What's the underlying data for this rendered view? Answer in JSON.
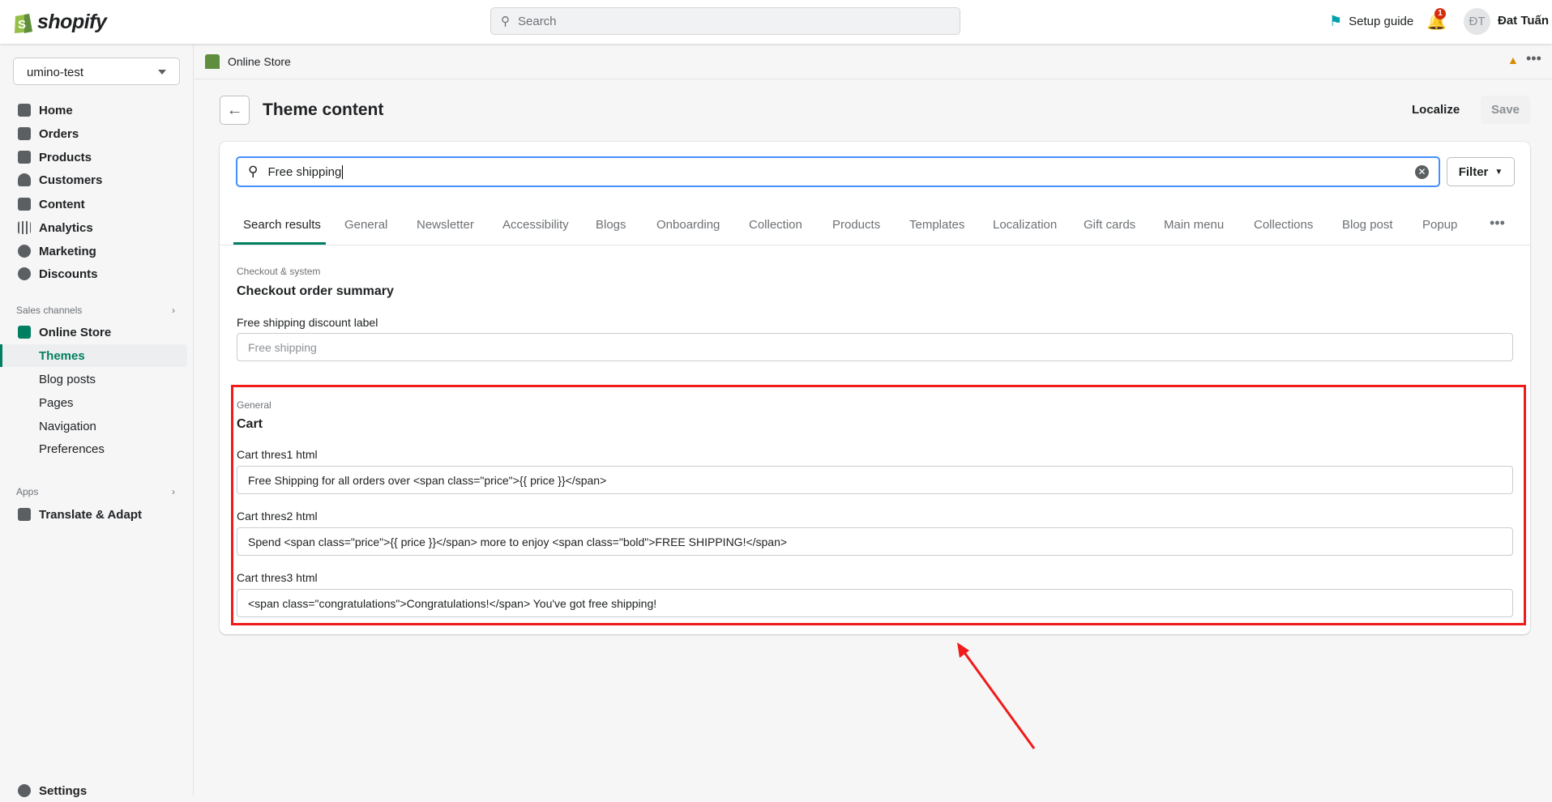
{
  "topbar": {
    "logo": "shopify",
    "search_placeholder": "Search",
    "setup_guide": "Setup guide",
    "notifications": "1",
    "avatar_initials": "ĐT",
    "user_name": "Đat Tuấn"
  },
  "sidebar": {
    "store": "umino-test",
    "items": [
      {
        "label": "Home",
        "icon": "home-icon"
      },
      {
        "label": "Orders",
        "icon": "orders-icon"
      },
      {
        "label": "Products",
        "icon": "tag-icon"
      },
      {
        "label": "Customers",
        "icon": "person-icon"
      },
      {
        "label": "Content",
        "icon": "image-icon"
      },
      {
        "label": "Analytics",
        "icon": "bar-chart-icon"
      },
      {
        "label": "Marketing",
        "icon": "target-icon"
      },
      {
        "label": "Discounts",
        "icon": "discount-icon"
      }
    ],
    "sales_channels": "Sales channels",
    "online_store": "Online Store",
    "sub_items": [
      "Themes",
      "Blog posts",
      "Pages",
      "Navigation",
      "Preferences"
    ],
    "apps": "Apps",
    "translate": "Translate & Adapt",
    "settings": "Settings"
  },
  "channel_bar": {
    "title": "Online Store"
  },
  "page": {
    "title": "Theme content",
    "localize": "Localize",
    "save": "Save",
    "search_value": "Free shipping",
    "filter": "Filter",
    "tabs": [
      "Search results",
      "General",
      "Newsletter",
      "Accessibility",
      "Blogs",
      "Onboarding",
      "Collection",
      "Products",
      "Templates",
      "Localization",
      "Gift cards",
      "Main menu",
      "Collections",
      "Blog post",
      "Popup"
    ],
    "sections": [
      {
        "category": "Checkout & system",
        "title": "Checkout order summary",
        "fields": [
          {
            "label": "Free shipping discount label",
            "placeholder": "Free shipping"
          }
        ]
      },
      {
        "category": "General",
        "title": "Cart",
        "fields": [
          {
            "label": "Cart thres1 html",
            "value": "Free Shipping for all orders over <span class=\"price\">{{ price }}</span>"
          },
          {
            "label": "Cart thres2 html",
            "value": "Spend <span class=\"price\">{{ price }}</span> more to enjoy <span class=\"bold\">FREE SHIPPING!</span>"
          },
          {
            "label": "Cart thres3 html",
            "value": "<span class=\"congratulations\">Congratulations!</span> You've got free shipping!"
          }
        ]
      }
    ]
  },
  "colors": {
    "accent": "#008060",
    "highlight": "#f01b1b",
    "focus": "#458fff"
  }
}
